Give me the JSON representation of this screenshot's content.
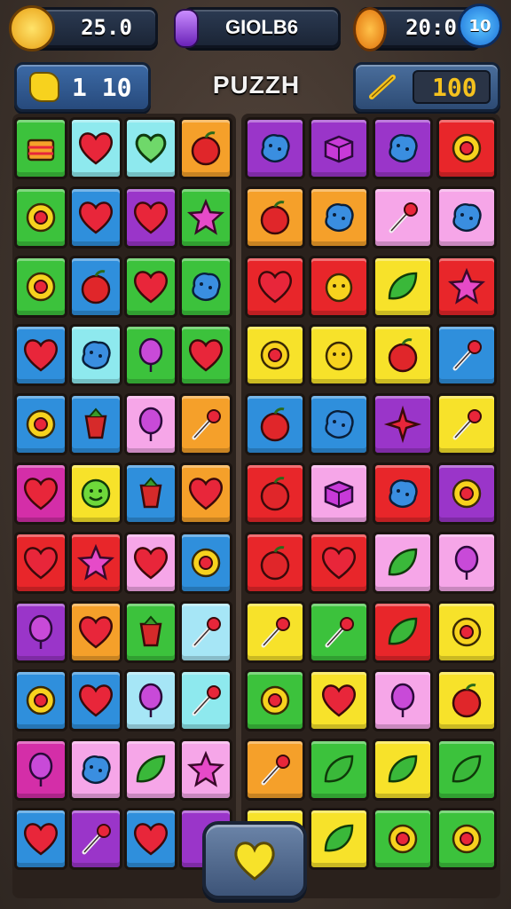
{
  "hud": {
    "left_coins": "25.0",
    "center_label": "GIOLB6",
    "right_coins": "20:0",
    "right_badge": "10",
    "title": "PUZZH",
    "left_panel_value": "1 10",
    "right_panel_value": "100"
  },
  "colors": {
    "green": "#3cc23c",
    "cyan": "#8ee9ee",
    "orange": "#f5a02a",
    "purple": "#9a35c9",
    "red": "#e8262a",
    "yellow": "#f7e22a",
    "pink": "#f6a6e8",
    "blue": "#2f8fdc",
    "lightblue": "#a6e6f6",
    "magenta": "#d42ea8"
  },
  "board_left": [
    [
      "green",
      "cyan",
      "cyan",
      "orange"
    ],
    [
      "green",
      "blue",
      "purple",
      "green"
    ],
    [
      "green",
      "blue",
      "green",
      "green"
    ],
    [
      "blue",
      "cyan",
      "green",
      "green"
    ],
    [
      "blue",
      "blue",
      "pink",
      "orange"
    ],
    [
      "magenta",
      "yellow",
      "blue",
      "orange"
    ],
    [
      "red",
      "red",
      "pink",
      "blue"
    ],
    [
      "purple",
      "orange",
      "green",
      "lightblue"
    ],
    [
      "blue",
      "blue",
      "lightblue",
      "cyan"
    ],
    [
      "magenta",
      "pink",
      "pink",
      "pink"
    ],
    [
      "blue",
      "purple",
      "blue",
      "purple"
    ]
  ],
  "board_right": [
    [
      "purple",
      "purple",
      "purple",
      "red"
    ],
    [
      "orange",
      "orange",
      "pink",
      "pink"
    ],
    [
      "red",
      "red",
      "yellow",
      "red"
    ],
    [
      "yellow",
      "yellow",
      "yellow",
      "blue"
    ],
    [
      "blue",
      "blue",
      "purple",
      "yellow"
    ],
    [
      "red",
      "pink",
      "red",
      "purple"
    ],
    [
      "red",
      "red",
      "pink",
      "pink"
    ],
    [
      "yellow",
      "green",
      "red",
      "yellow"
    ],
    [
      "green",
      "yellow",
      "pink",
      "yellow"
    ],
    [
      "orange",
      "green",
      "yellow",
      "green"
    ],
    [
      "yellow",
      "yellow",
      "green",
      "green"
    ]
  ],
  "icons_left": [
    [
      "cake",
      "heart",
      "heart-outline",
      "apple"
    ],
    [
      "ring",
      "heart",
      "heart",
      "star"
    ],
    [
      "ring",
      "apple",
      "heart",
      "blob"
    ],
    [
      "heart",
      "blob",
      "balloon",
      "heart"
    ],
    [
      "ring",
      "berry",
      "balloon",
      "candy"
    ],
    [
      "heart",
      "smiley",
      "berry",
      "heart"
    ],
    [
      "heart",
      "star",
      "heart",
      "ring"
    ],
    [
      "balloon",
      "heart",
      "berry",
      "candy"
    ],
    [
      "ring",
      "heart",
      "balloon",
      "candy"
    ],
    [
      "balloon",
      "blob",
      "leaf",
      "star"
    ],
    [
      "heart",
      "candy",
      "heart",
      "none"
    ]
  ],
  "icons_right": [
    [
      "blob",
      "box",
      "blob",
      "ring"
    ],
    [
      "apple",
      "blob",
      "candy",
      "blob"
    ],
    [
      "heart",
      "face",
      "leaf",
      "star"
    ],
    [
      "ring",
      "face",
      "apple",
      "candy"
    ],
    [
      "apple",
      "blob",
      "spark",
      "candy"
    ],
    [
      "apple",
      "box",
      "blob",
      "ring"
    ],
    [
      "apple",
      "heart",
      "leaf",
      "balloon"
    ],
    [
      "candy",
      "candy",
      "leaf",
      "ring"
    ],
    [
      "ring",
      "heart",
      "balloon",
      "apple"
    ],
    [
      "candy",
      "leaf",
      "leaf",
      "leaf"
    ],
    [
      "berry",
      "leaf",
      "ring",
      "ring"
    ]
  ]
}
